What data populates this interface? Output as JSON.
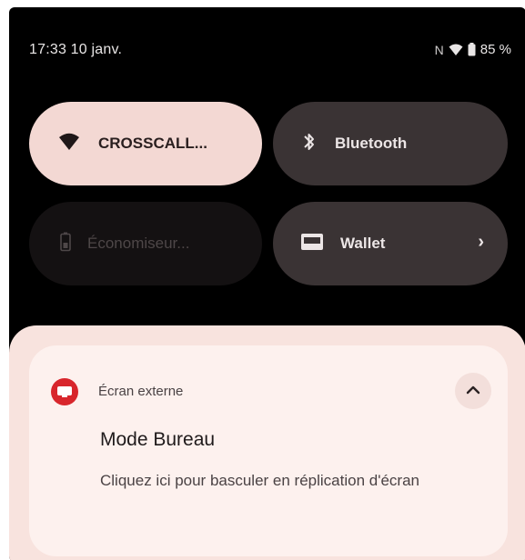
{
  "status_bar": {
    "time_date": "17:33 10 janv.",
    "nfc_indicator": "N",
    "battery_percent": "85 %"
  },
  "quick_tiles": [
    {
      "label": "CROSSCALL...",
      "icon": "wifi-icon",
      "state": "on"
    },
    {
      "label": "Bluetooth",
      "icon": "bluetooth-icon",
      "state": "off"
    },
    {
      "label": "Économiseur...",
      "icon": "battery-saver-icon",
      "state": "unavailable"
    },
    {
      "label": "Wallet",
      "icon": "wallet-icon",
      "state": "off"
    }
  ],
  "notification": {
    "app_name": "Écran externe",
    "title": "Mode Bureau",
    "text": "Cliquez ici pour basculer en réplication d'écran",
    "app_icon": "external-display-icon",
    "expand_icon": "chevron-up-icon"
  },
  "colors": {
    "background": "#000000",
    "tile_active": "#f3d8d3",
    "tile_inactive": "#3a3334",
    "tile_disabled": "#141112",
    "notification_sheet": "#f8e3de",
    "notification_card": "#fdf1ee",
    "app_icon": "#d8262c"
  }
}
